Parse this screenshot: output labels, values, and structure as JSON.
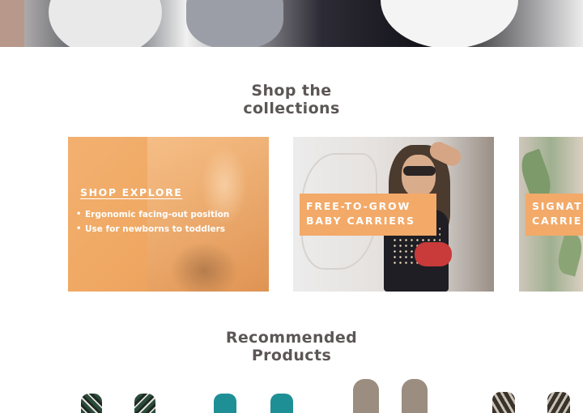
{
  "collections": {
    "title": "Shop the collections",
    "cards": [
      {
        "link_label": "SHOP EXPLORE",
        "bullets": [
          "Ergonomic facing-out position",
          "Use for newborns to toddlers"
        ]
      },
      {
        "label_line1": "FREE-TO-GROW",
        "label_line2": "BABY CARRIERS"
      },
      {
        "label_line1": "SIGNATURE",
        "label_line2": "CARRIERS"
      }
    ]
  },
  "recommended": {
    "title": "Recommended Products"
  },
  "colors": {
    "accent_orange": "#f3a968",
    "title_text": "#5c5656"
  }
}
